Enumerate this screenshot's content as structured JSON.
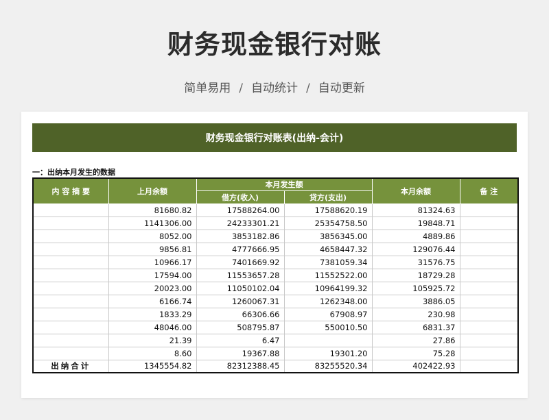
{
  "header": {
    "title": "财务现金银行对账",
    "subtitle": [
      "简单易用",
      "自动统计",
      "自动更新"
    ],
    "subtitle_sep": "/"
  },
  "sheet": {
    "banner": "财务现金银行对账表(出纳-会计)",
    "section_title": "一：出纳本月发生的数据",
    "columns": {
      "content": "内 容 摘 要",
      "opening": "上月余额",
      "movement": "本月发生额",
      "debit": "借方(收入)",
      "credit": "贷方(支出)",
      "closing": "本月余额",
      "note": "备  注"
    },
    "rows": [
      {
        "content": "",
        "opening": "81680.82",
        "debit": "17588264.00",
        "credit": "17588620.19",
        "closing": "81324.63",
        "note": ""
      },
      {
        "content": "",
        "opening": "1141306.00",
        "debit": "24233301.21",
        "credit": "25354758.50",
        "closing": "19848.71",
        "note": ""
      },
      {
        "content": "",
        "opening": "8052.00",
        "debit": "3853182.86",
        "credit": "3856345.00",
        "closing": "4889.86",
        "note": ""
      },
      {
        "content": "",
        "opening": "9856.81",
        "debit": "4777666.95",
        "credit": "4658447.32",
        "closing": "129076.44",
        "note": ""
      },
      {
        "content": "",
        "opening": "10966.17",
        "debit": "7401669.92",
        "credit": "7381059.34",
        "closing": "31576.75",
        "note": ""
      },
      {
        "content": "",
        "opening": "17594.00",
        "debit": "11553657.28",
        "credit": "11552522.00",
        "closing": "18729.28",
        "note": ""
      },
      {
        "content": "",
        "opening": "20023.00",
        "debit": "11050102.04",
        "credit": "10964199.32",
        "closing": "105925.72",
        "note": ""
      },
      {
        "content": "",
        "opening": "6166.74",
        "debit": "1260067.31",
        "credit": "1262348.00",
        "closing": "3886.05",
        "note": ""
      },
      {
        "content": "",
        "opening": "1833.29",
        "debit": "66306.66",
        "credit": "67908.97",
        "closing": "230.98",
        "note": ""
      },
      {
        "content": "",
        "opening": "48046.00",
        "debit": "508795.87",
        "credit": "550010.50",
        "closing": "6831.37",
        "note": ""
      },
      {
        "content": "",
        "opening": "21.39",
        "debit": "6.47",
        "credit": "",
        "closing": "27.86",
        "note": ""
      },
      {
        "content": "",
        "opening": "8.60",
        "debit": "19367.88",
        "credit": "19301.20",
        "closing": "75.28",
        "note": ""
      }
    ],
    "total": {
      "label": "出纳合计",
      "opening": "1345554.82",
      "debit": "82312388.45",
      "credit": "83255520.34",
      "closing": "402422.93",
      "note": ""
    }
  },
  "colors": {
    "banner": "#4f6228",
    "table_header": "#76923c",
    "page_bg": "#f0f0f0"
  }
}
